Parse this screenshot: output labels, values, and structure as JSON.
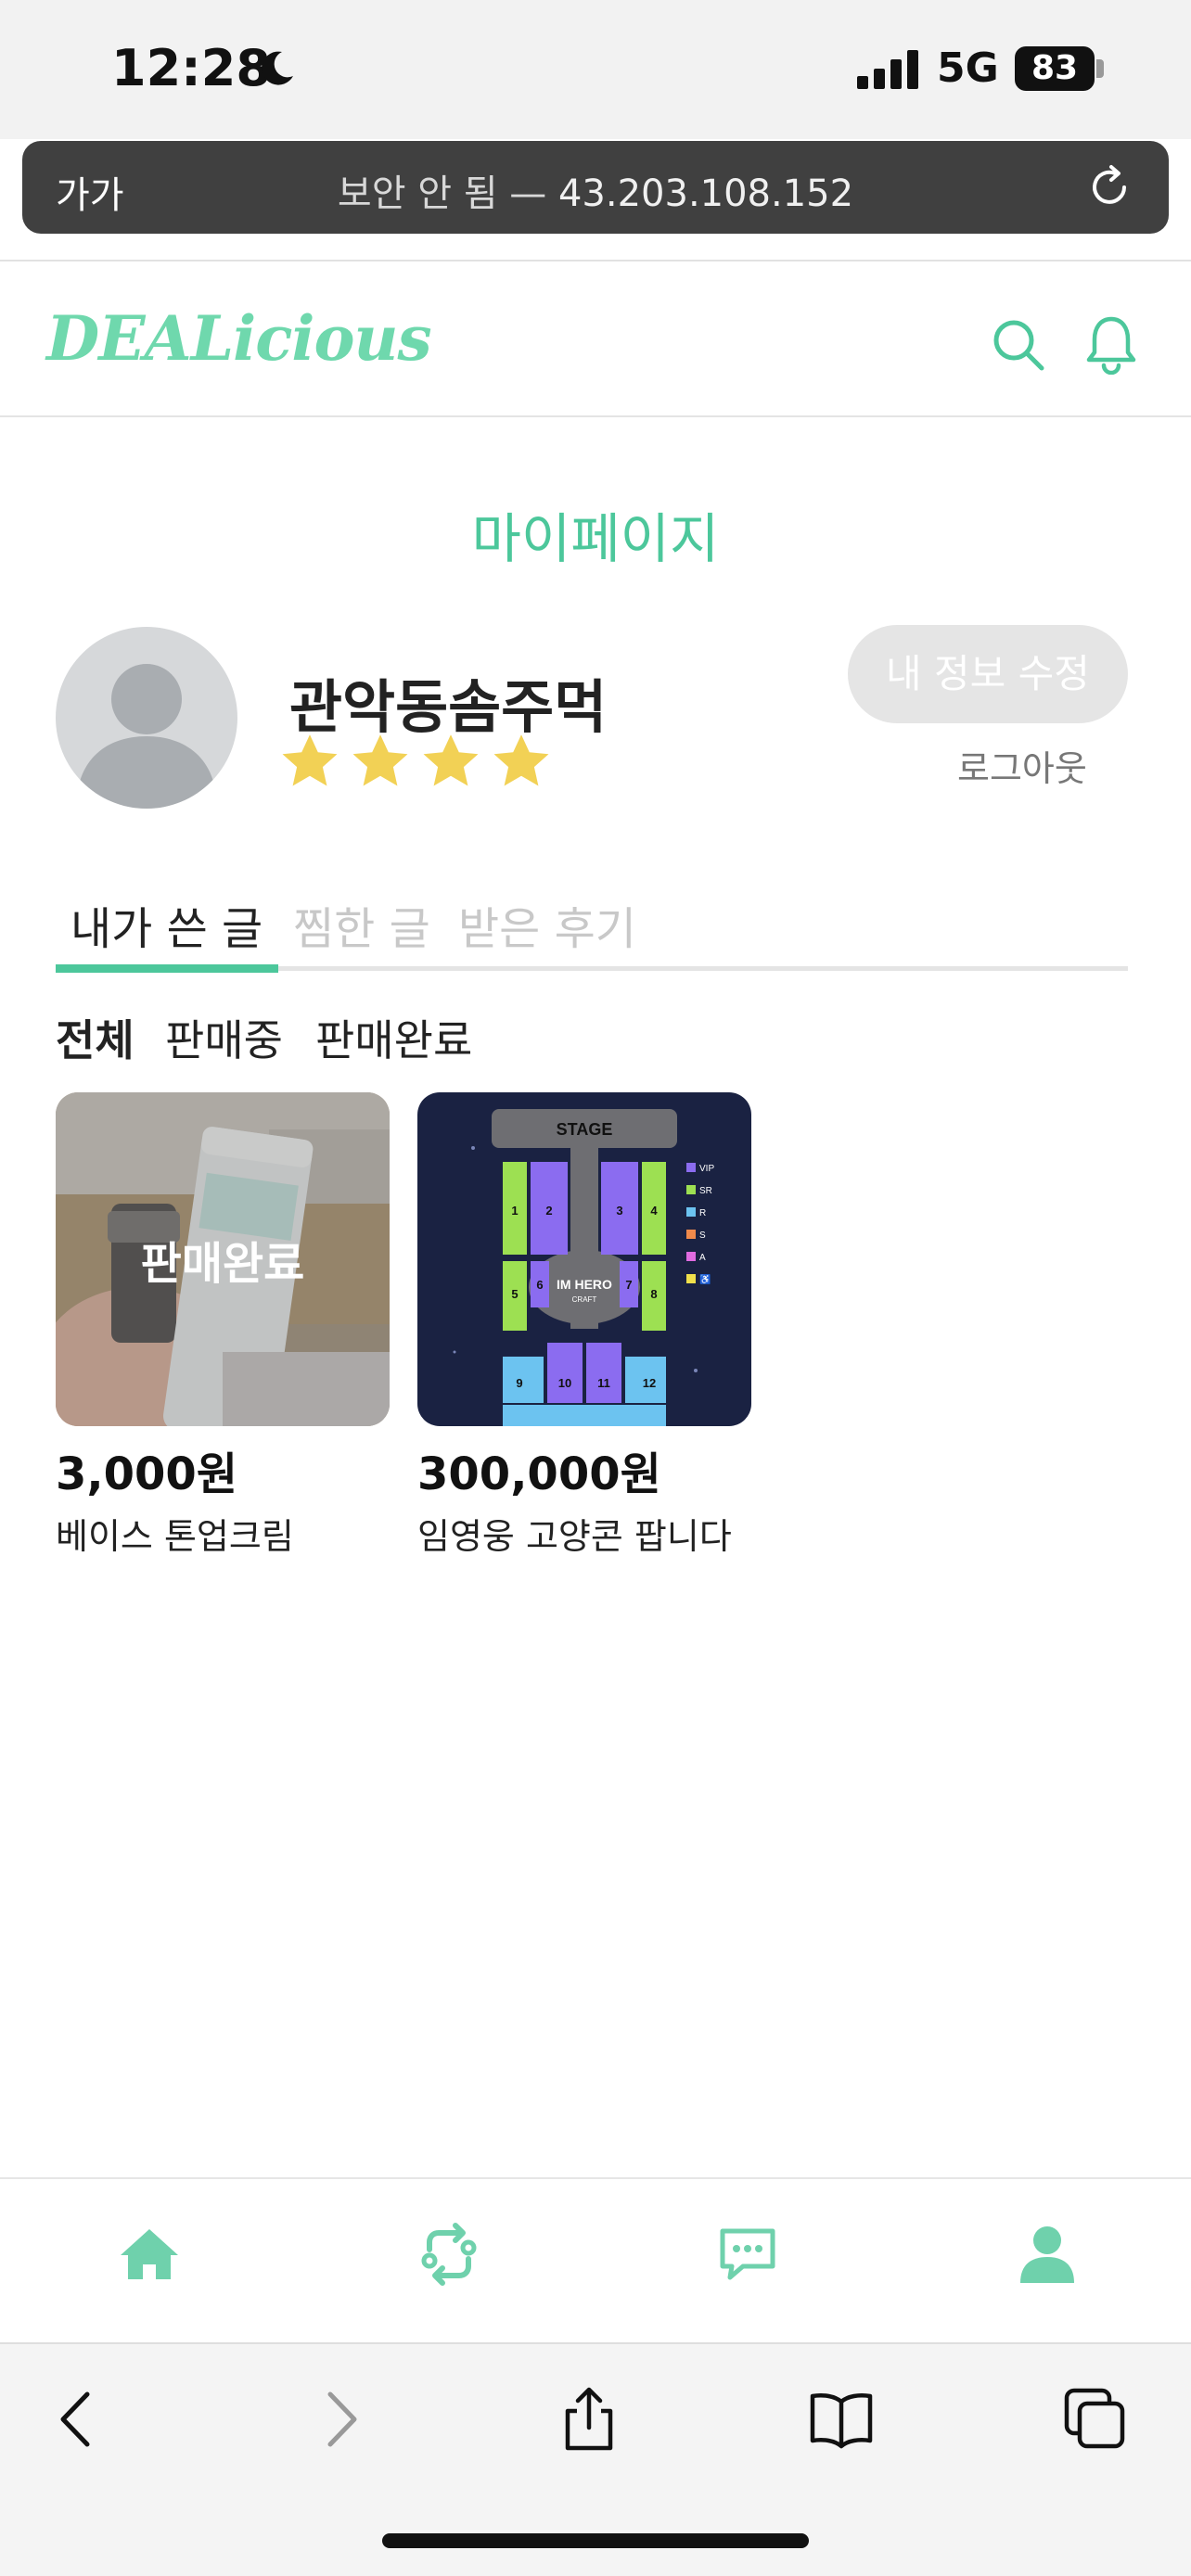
{
  "status_bar": {
    "time": "12:28",
    "network": "5G",
    "battery": "83"
  },
  "url_bar": {
    "text_size": "가가",
    "insecure": "보안 안 됨 —",
    "host": "43.203.108.152"
  },
  "header": {
    "logo": "DEALicious"
  },
  "page": {
    "title": "마이페이지"
  },
  "profile": {
    "nickname": "관악동솜주먹",
    "rating": 4,
    "rating_max": 4,
    "edit_label": "내 정보 수정",
    "logout_label": "로그아웃"
  },
  "tabs": [
    {
      "label": "내가 쓴 글",
      "active": true
    },
    {
      "label": "찜한 글",
      "active": false
    },
    {
      "label": "받은 후기",
      "active": false
    }
  ],
  "filters": [
    {
      "label": "전체",
      "active": true
    },
    {
      "label": "판매중",
      "active": false
    },
    {
      "label": "판매완료",
      "active": false
    }
  ],
  "posts": [
    {
      "price": "3,000원",
      "title": "베이스 톤업크림",
      "status": "판매완료",
      "image": "toneup-cream-photo"
    },
    {
      "price": "300,000원",
      "title": "임영웅 고양콘 팝니다",
      "status": "",
      "image": "concert-seat-map",
      "map_labels": {
        "stage": "STAGE",
        "center": "IM HERO",
        "center_sub": "CRAFT",
        "legend": [
          "VIP",
          "SR",
          "R",
          "S",
          "A",
          "♿"
        ],
        "sections": [
          "1",
          "2",
          "3",
          "4",
          "5",
          "6",
          "7",
          "8",
          "9",
          "10",
          "11",
          "12"
        ]
      }
    }
  ],
  "colors": {
    "accent": "#4cc79b",
    "logo": "#6fd8ad",
    "star": "#f2d155"
  }
}
